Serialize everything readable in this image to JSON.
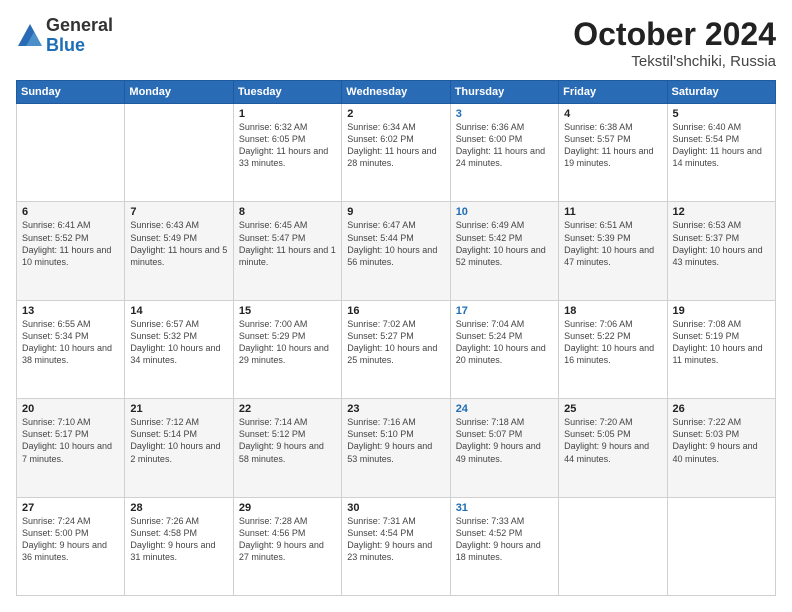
{
  "logo": {
    "general": "General",
    "blue": "Blue"
  },
  "header": {
    "month": "October 2024",
    "location": "Tekstil'shchiki, Russia"
  },
  "weekdays": [
    "Sunday",
    "Monday",
    "Tuesday",
    "Wednesday",
    "Thursday",
    "Friday",
    "Saturday"
  ],
  "weeks": [
    [
      {
        "day": "",
        "sunrise": "",
        "sunset": "",
        "daylight": ""
      },
      {
        "day": "",
        "sunrise": "",
        "sunset": "",
        "daylight": ""
      },
      {
        "day": "1",
        "sunrise": "Sunrise: 6:32 AM",
        "sunset": "Sunset: 6:05 PM",
        "daylight": "Daylight: 11 hours and 33 minutes."
      },
      {
        "day": "2",
        "sunrise": "Sunrise: 6:34 AM",
        "sunset": "Sunset: 6:02 PM",
        "daylight": "Daylight: 11 hours and 28 minutes."
      },
      {
        "day": "3",
        "sunrise": "Sunrise: 6:36 AM",
        "sunset": "Sunset: 6:00 PM",
        "daylight": "Daylight: 11 hours and 24 minutes.",
        "thursday": true
      },
      {
        "day": "4",
        "sunrise": "Sunrise: 6:38 AM",
        "sunset": "Sunset: 5:57 PM",
        "daylight": "Daylight: 11 hours and 19 minutes."
      },
      {
        "day": "5",
        "sunrise": "Sunrise: 6:40 AM",
        "sunset": "Sunset: 5:54 PM",
        "daylight": "Daylight: 11 hours and 14 minutes."
      }
    ],
    [
      {
        "day": "6",
        "sunrise": "Sunrise: 6:41 AM",
        "sunset": "Sunset: 5:52 PM",
        "daylight": "Daylight: 11 hours and 10 minutes."
      },
      {
        "day": "7",
        "sunrise": "Sunrise: 6:43 AM",
        "sunset": "Sunset: 5:49 PM",
        "daylight": "Daylight: 11 hours and 5 minutes."
      },
      {
        "day": "8",
        "sunrise": "Sunrise: 6:45 AM",
        "sunset": "Sunset: 5:47 PM",
        "daylight": "Daylight: 11 hours and 1 minute."
      },
      {
        "day": "9",
        "sunrise": "Sunrise: 6:47 AM",
        "sunset": "Sunset: 5:44 PM",
        "daylight": "Daylight: 10 hours and 56 minutes."
      },
      {
        "day": "10",
        "sunrise": "Sunrise: 6:49 AM",
        "sunset": "Sunset: 5:42 PM",
        "daylight": "Daylight: 10 hours and 52 minutes.",
        "thursday": true
      },
      {
        "day": "11",
        "sunrise": "Sunrise: 6:51 AM",
        "sunset": "Sunset: 5:39 PM",
        "daylight": "Daylight: 10 hours and 47 minutes."
      },
      {
        "day": "12",
        "sunrise": "Sunrise: 6:53 AM",
        "sunset": "Sunset: 5:37 PM",
        "daylight": "Daylight: 10 hours and 43 minutes."
      }
    ],
    [
      {
        "day": "13",
        "sunrise": "Sunrise: 6:55 AM",
        "sunset": "Sunset: 5:34 PM",
        "daylight": "Daylight: 10 hours and 38 minutes."
      },
      {
        "day": "14",
        "sunrise": "Sunrise: 6:57 AM",
        "sunset": "Sunset: 5:32 PM",
        "daylight": "Daylight: 10 hours and 34 minutes."
      },
      {
        "day": "15",
        "sunrise": "Sunrise: 7:00 AM",
        "sunset": "Sunset: 5:29 PM",
        "daylight": "Daylight: 10 hours and 29 minutes."
      },
      {
        "day": "16",
        "sunrise": "Sunrise: 7:02 AM",
        "sunset": "Sunset: 5:27 PM",
        "daylight": "Daylight: 10 hours and 25 minutes."
      },
      {
        "day": "17",
        "sunrise": "Sunrise: 7:04 AM",
        "sunset": "Sunset: 5:24 PM",
        "daylight": "Daylight: 10 hours and 20 minutes.",
        "thursday": true
      },
      {
        "day": "18",
        "sunrise": "Sunrise: 7:06 AM",
        "sunset": "Sunset: 5:22 PM",
        "daylight": "Daylight: 10 hours and 16 minutes."
      },
      {
        "day": "19",
        "sunrise": "Sunrise: 7:08 AM",
        "sunset": "Sunset: 5:19 PM",
        "daylight": "Daylight: 10 hours and 11 minutes."
      }
    ],
    [
      {
        "day": "20",
        "sunrise": "Sunrise: 7:10 AM",
        "sunset": "Sunset: 5:17 PM",
        "daylight": "Daylight: 10 hours and 7 minutes."
      },
      {
        "day": "21",
        "sunrise": "Sunrise: 7:12 AM",
        "sunset": "Sunset: 5:14 PM",
        "daylight": "Daylight: 10 hours and 2 minutes."
      },
      {
        "day": "22",
        "sunrise": "Sunrise: 7:14 AM",
        "sunset": "Sunset: 5:12 PM",
        "daylight": "Daylight: 9 hours and 58 minutes."
      },
      {
        "day": "23",
        "sunrise": "Sunrise: 7:16 AM",
        "sunset": "Sunset: 5:10 PM",
        "daylight": "Daylight: 9 hours and 53 minutes."
      },
      {
        "day": "24",
        "sunrise": "Sunrise: 7:18 AM",
        "sunset": "Sunset: 5:07 PM",
        "daylight": "Daylight: 9 hours and 49 minutes.",
        "thursday": true
      },
      {
        "day": "25",
        "sunrise": "Sunrise: 7:20 AM",
        "sunset": "Sunset: 5:05 PM",
        "daylight": "Daylight: 9 hours and 44 minutes."
      },
      {
        "day": "26",
        "sunrise": "Sunrise: 7:22 AM",
        "sunset": "Sunset: 5:03 PM",
        "daylight": "Daylight: 9 hours and 40 minutes."
      }
    ],
    [
      {
        "day": "27",
        "sunrise": "Sunrise: 7:24 AM",
        "sunset": "Sunset: 5:00 PM",
        "daylight": "Daylight: 9 hours and 36 minutes."
      },
      {
        "day": "28",
        "sunrise": "Sunrise: 7:26 AM",
        "sunset": "Sunset: 4:58 PM",
        "daylight": "Daylight: 9 hours and 31 minutes."
      },
      {
        "day": "29",
        "sunrise": "Sunrise: 7:28 AM",
        "sunset": "Sunset: 4:56 PM",
        "daylight": "Daylight: 9 hours and 27 minutes."
      },
      {
        "day": "30",
        "sunrise": "Sunrise: 7:31 AM",
        "sunset": "Sunset: 4:54 PM",
        "daylight": "Daylight: 9 hours and 23 minutes."
      },
      {
        "day": "31",
        "sunrise": "Sunrise: 7:33 AM",
        "sunset": "Sunset: 4:52 PM",
        "daylight": "Daylight: 9 hours and 18 minutes.",
        "thursday": true
      },
      {
        "day": "",
        "sunrise": "",
        "sunset": "",
        "daylight": ""
      },
      {
        "day": "",
        "sunrise": "",
        "sunset": "",
        "daylight": ""
      }
    ]
  ]
}
